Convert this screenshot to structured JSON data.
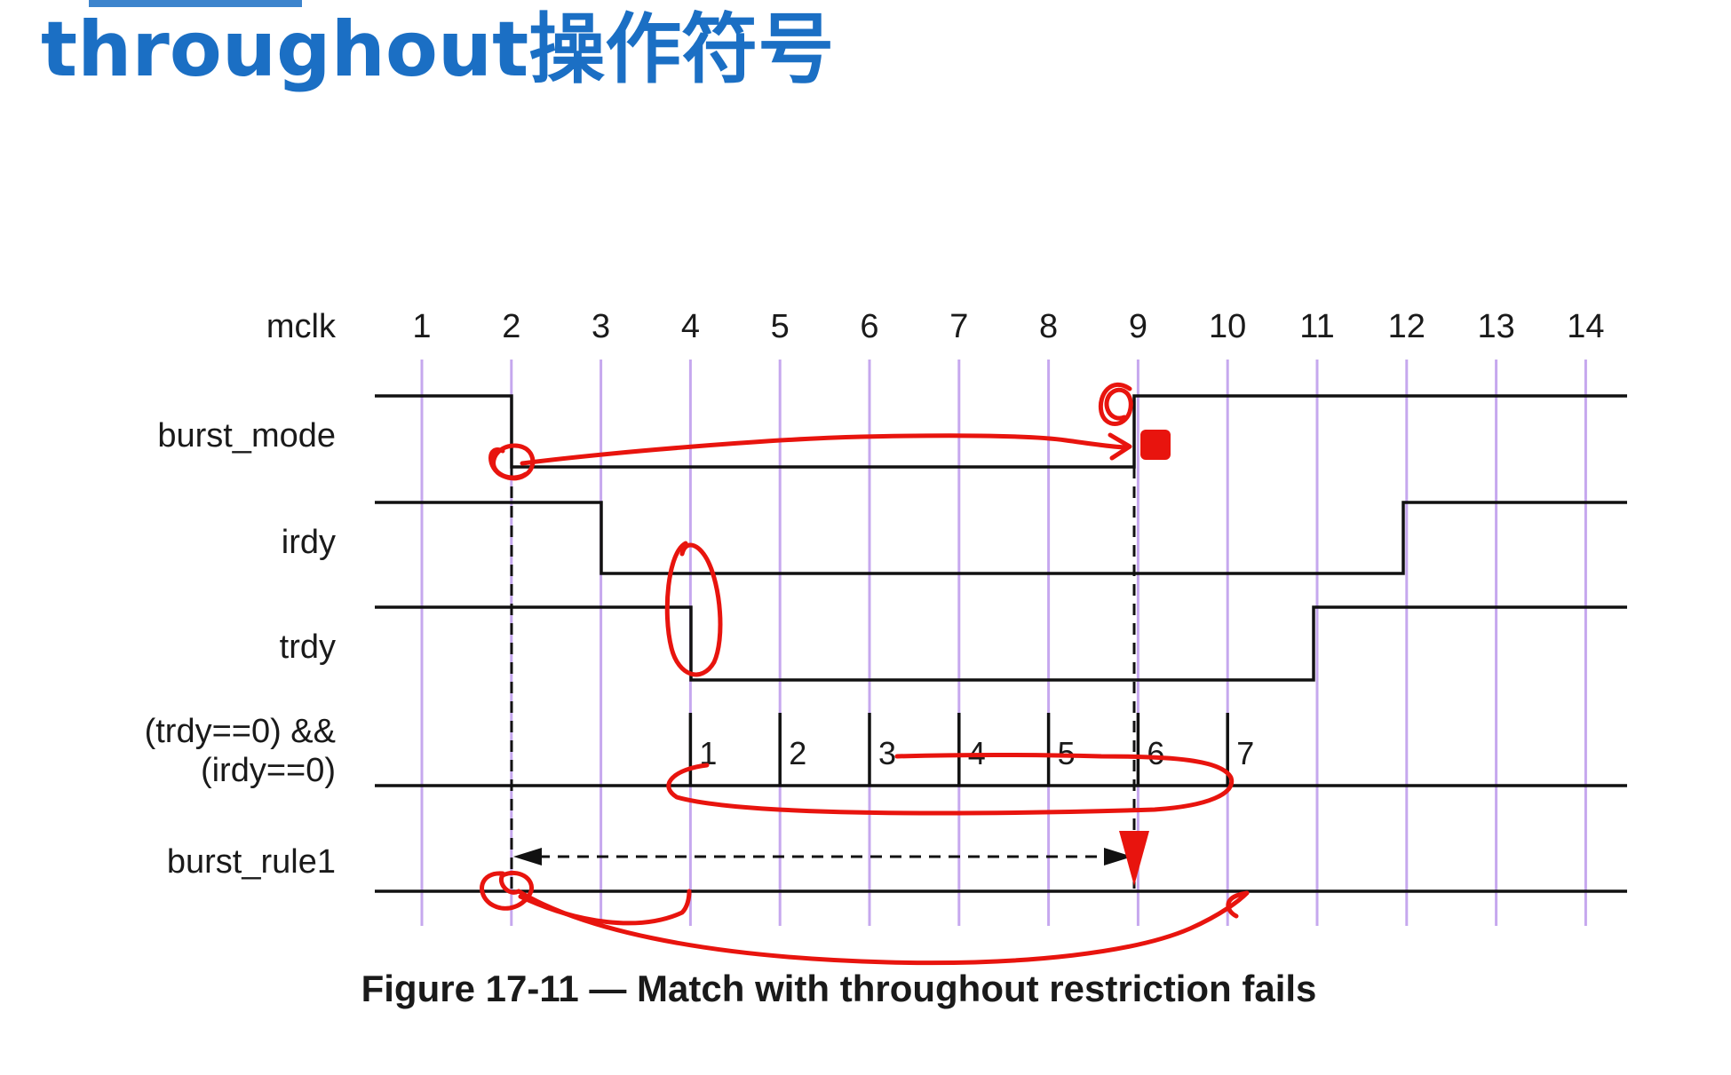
{
  "slide": {
    "title": "throughout操作符号"
  },
  "diagram": {
    "clock_label": "mclk",
    "clock_ticks": [
      "1",
      "2",
      "3",
      "4",
      "5",
      "6",
      "7",
      "8",
      "9",
      "10",
      "11",
      "12",
      "13",
      "14"
    ],
    "signals": [
      {
        "id": "burst_mode",
        "label_lines": [
          "burst_mode"
        ]
      },
      {
        "id": "irdy",
        "label_lines": [
          "irdy"
        ]
      },
      {
        "id": "trdy",
        "label_lines": [
          "trdy"
        ]
      },
      {
        "id": "both_low",
        "label_lines": [
          "(trdy==0) &&",
          "(irdy==0)"
        ]
      },
      {
        "id": "burst_rule1",
        "label_lines": [
          "burst_rule1"
        ]
      }
    ],
    "match_counts": [
      "1",
      "2",
      "3",
      "4",
      "5",
      "6",
      "7"
    ],
    "caption": "Figure 17-11 — Match with throughout restriction fails",
    "colors": {
      "clock_line": "#c6a8ee",
      "waveform": "#111111",
      "annotation": "#e8140e",
      "title": "#1b6fc4"
    }
  }
}
